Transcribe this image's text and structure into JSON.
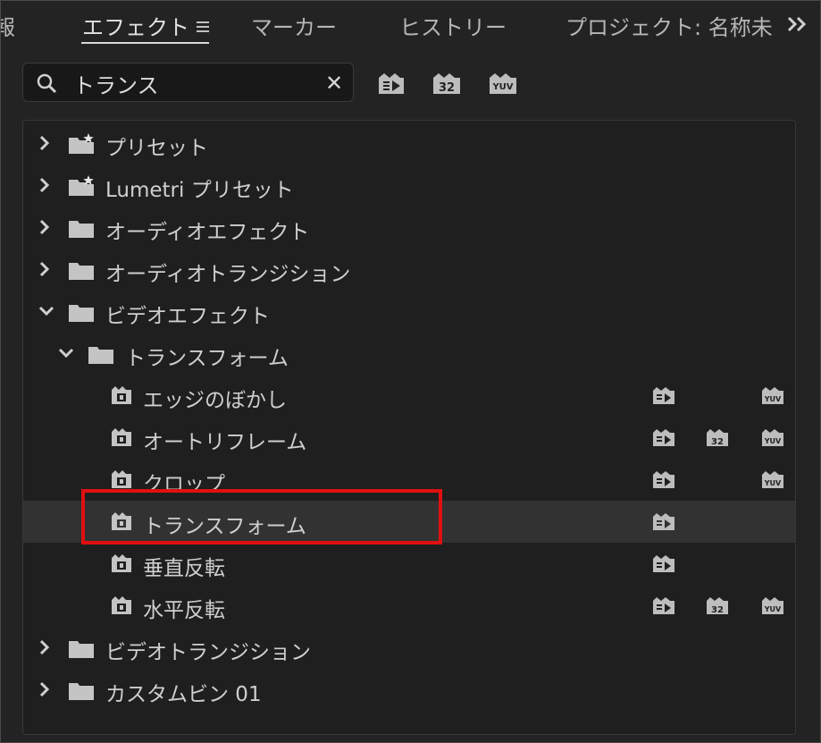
{
  "tabs": {
    "partial_left": "報",
    "effects": "エフェクト",
    "markers": "マーカー",
    "history": "ヒストリー",
    "project": "プロジェクト: 名称未"
  },
  "search": {
    "value": "トランス",
    "placeholder": ""
  },
  "tree": {
    "presets": "プリセット",
    "lumetri_presets": "Lumetri プリセット",
    "audio_effects": "オーディオエフェクト",
    "audio_transitions": "オーディオトランジション",
    "video_effects": "ビデオエフェクト",
    "transform_folder": "トランスフォーム",
    "items": [
      {
        "label": "エッジのぼかし",
        "accel": true,
        "bit32": false,
        "yuv": true
      },
      {
        "label": "オートリフレーム",
        "accel": true,
        "bit32": true,
        "yuv": true
      },
      {
        "label": "クロップ",
        "accel": true,
        "bit32": false,
        "yuv": true
      },
      {
        "label": "トランスフォーム",
        "accel": true,
        "bit32": false,
        "yuv": false
      },
      {
        "label": "垂直反転",
        "accel": true,
        "bit32": false,
        "yuv": false
      },
      {
        "label": "水平反転",
        "accel": true,
        "bit32": true,
        "yuv": true
      }
    ],
    "video_transitions": "ビデオトランジション",
    "custom_bin": "カスタムビン 01"
  },
  "badges": {
    "bit32": "32",
    "yuv": "YUV"
  },
  "colors": {
    "background": "#232323",
    "panel": "#1f1f1f",
    "selected_row": "#323232",
    "highlight": "#e01010"
  }
}
